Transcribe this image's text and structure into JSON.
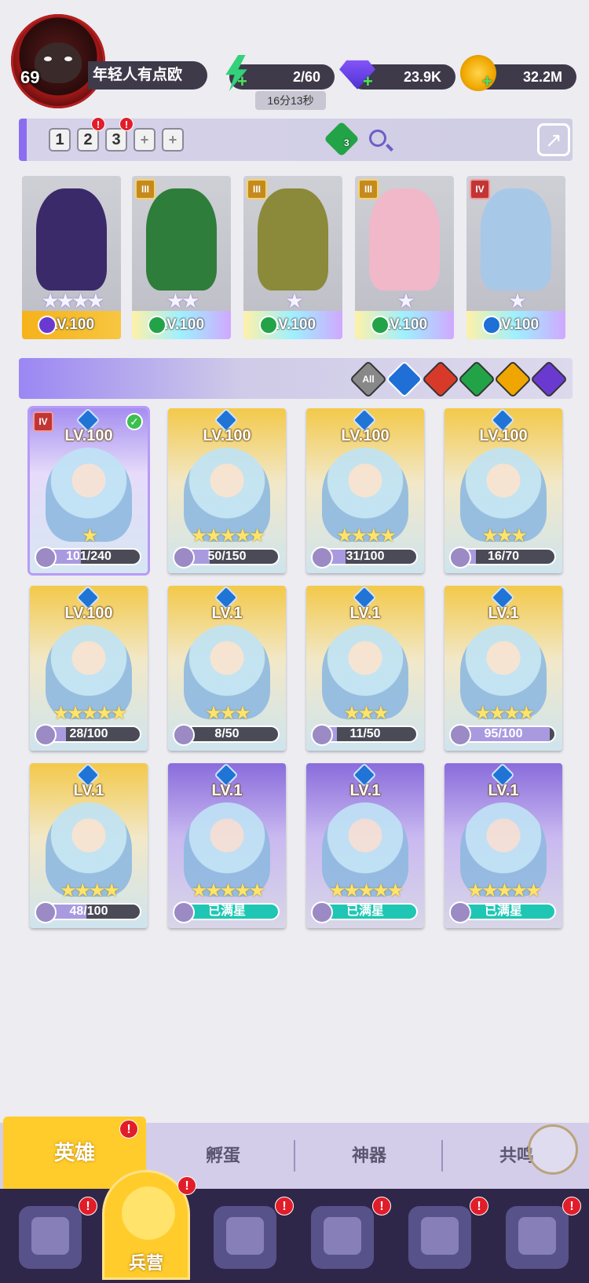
{
  "profile": {
    "level": "69",
    "name": "年轻人有点欧"
  },
  "resources": {
    "energy": "2/60",
    "energy_timer": "16分13秒",
    "gems": "23.9K",
    "coins": "32.2M"
  },
  "team_tabs": [
    {
      "label": "1",
      "active": true,
      "badge": ""
    },
    {
      "label": "2",
      "active": false,
      "badge": "!"
    },
    {
      "label": "3",
      "active": false,
      "badge": "!"
    },
    {
      "label": "+",
      "active": false,
      "badge": ""
    },
    {
      "label": "+",
      "active": false,
      "badge": ""
    }
  ],
  "dice_count": "3",
  "team_heroes": [
    {
      "level": "LV.100",
      "rank": "",
      "stars": "★★★★",
      "element": "dark",
      "color": "#3a2a6a"
    },
    {
      "level": "LV.100",
      "rank": "III",
      "stars": "★★",
      "element": "wind",
      "color": "#2e7d3a"
    },
    {
      "level": "LV.100",
      "rank": "III",
      "stars": "★",
      "element": "wind",
      "color": "#8a8a3a"
    },
    {
      "level": "LV.100",
      "rank": "III",
      "stars": "★",
      "element": "wind",
      "color": "#f0b8c8"
    },
    {
      "level": "LV.100",
      "rank": "IV",
      "stars": "★",
      "element": "water",
      "color": "#a8c8e8"
    }
  ],
  "filters": [
    "All",
    "water",
    "fire",
    "wind",
    "light",
    "dark"
  ],
  "filter_colors": [
    "#888888",
    "#1f6fd6",
    "#d83a2a",
    "#23a347",
    "#f0a600",
    "#6a3ad0"
  ],
  "heroes": [
    {
      "level": "LV.100",
      "stars": "★",
      "progress": "101/240",
      "fill": 0.42,
      "card": "selected",
      "rank": "IV",
      "checked": true
    },
    {
      "level": "LV.100",
      "stars": "★★★★★",
      "progress": "50/150",
      "fill": 0.33,
      "card": "gold"
    },
    {
      "level": "LV.100",
      "stars": "★★★★",
      "progress": "31/100",
      "fill": 0.31,
      "card": "gold"
    },
    {
      "level": "LV.100",
      "stars": "★★★",
      "progress": "16/70",
      "fill": 0.23,
      "card": "gold"
    },
    {
      "level": "LV.100",
      "stars": "★★★★★",
      "progress": "28/100",
      "fill": 0.28,
      "card": "gold"
    },
    {
      "level": "LV.1",
      "stars": "★★★",
      "progress": "8/50",
      "fill": 0.16,
      "card": "gold"
    },
    {
      "level": "LV.1",
      "stars": "★★★",
      "progress": "11/50",
      "fill": 0.22,
      "card": "gold"
    },
    {
      "level": "LV.1",
      "stars": "★★★★",
      "progress": "95/100",
      "fill": 0.95,
      "card": "gold"
    },
    {
      "level": "LV.1",
      "stars": "★★★★",
      "progress": "48/100",
      "fill": 0.48,
      "card": "gold"
    },
    {
      "level": "LV.1",
      "stars": "★★★★★",
      "progress": "已满星",
      "fill": 1,
      "card": "purple",
      "maxed": true
    },
    {
      "level": "LV.1",
      "stars": "★★★★★",
      "progress": "已满星",
      "fill": 1,
      "card": "purple",
      "maxed": true
    },
    {
      "level": "LV.1",
      "stars": "★★★★★",
      "progress": "已满星",
      "fill": 1,
      "card": "purple",
      "maxed": true
    }
  ],
  "subtabs": [
    {
      "label": "英雄",
      "active": true,
      "badge": "!"
    },
    {
      "label": "孵蛋",
      "active": false
    },
    {
      "label": "神器",
      "active": false
    },
    {
      "label": "共鸣",
      "active": false
    }
  ],
  "nav": [
    {
      "icon": "cards-icon",
      "badge": "!"
    },
    {
      "icon": "barracks-icon",
      "label": "兵营",
      "active": true,
      "badge": "!"
    },
    {
      "icon": "book-icon",
      "badge": "!"
    },
    {
      "icon": "castle-icon",
      "badge": "!"
    },
    {
      "icon": "mushroom-icon",
      "badge": "!"
    },
    {
      "icon": "banner-icon",
      "badge": "!"
    }
  ]
}
